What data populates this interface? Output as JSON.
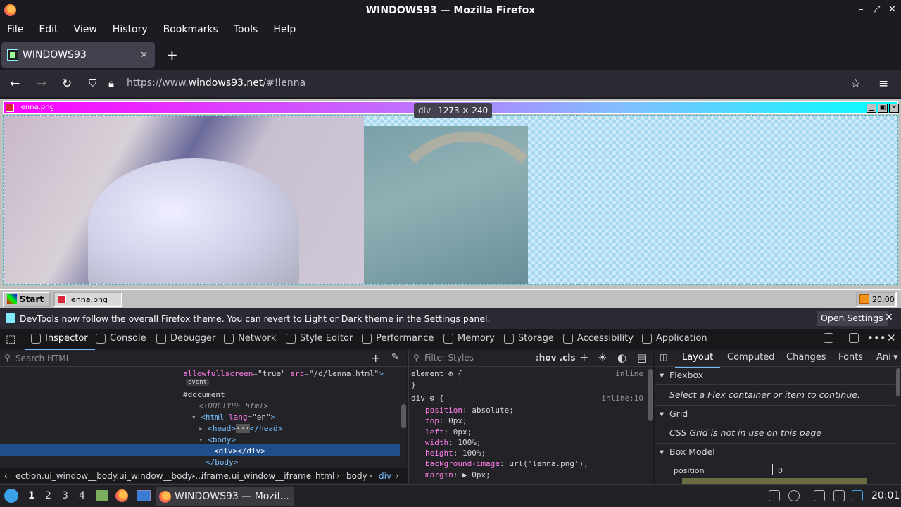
{
  "window": {
    "title": "WINDOWS93 — Mozilla Firefox"
  },
  "menubar": [
    "File",
    "Edit",
    "View",
    "History",
    "Bookmarks",
    "Tools",
    "Help"
  ],
  "tab": {
    "label": "WINDOWS93"
  },
  "navbar": {
    "url_prefix": "https://www.",
    "url_domain": "windows93.net",
    "url_suffix": "/#!lenna"
  },
  "win93": {
    "window_label": "lenna.png",
    "tooltip_tag": "div",
    "tooltip_size": "1273 × 240",
    "start_label": "Start",
    "task_label": "lenna.png",
    "clock": "20:00"
  },
  "notice": {
    "text": "DevTools now follow the overall Firefox theme. You can revert to Light or Dark theme in the Settings panel.",
    "button": "Open Settings"
  },
  "devtools": {
    "tabs": [
      "Inspector",
      "Console",
      "Debugger",
      "Network",
      "Style Editor",
      "Performance",
      "Memory",
      "Storage",
      "Accessibility",
      "Application"
    ],
    "search_placeholder": "Search HTML",
    "filter_placeholder": "Filter Styles",
    "pseudo": ":hov .cls",
    "html_lines": {
      "l1_att": "allowfullscreen",
      "l1_val": "\"true\"",
      "l1_src_att": "src",
      "l1_src_val": "\"/d/lenna.html\"",
      "event": "event",
      "document": "#document",
      "doctype": "<!DOCTYPE html>",
      "html_open": "<html",
      "lang_att": "lang",
      "lang_val": "\"en\"",
      "head": "<head>",
      "head_close": "</head>",
      "body": "<body>",
      "div": "<div></div>",
      "body_close": "</body>"
    },
    "breadcrumbs": [
      "ection.ui_window__body.ui_window__body-...",
      "iframe.ui_window__iframe",
      "html",
      "body",
      "div"
    ],
    "rules": {
      "element": "element",
      "element_src": "inline",
      "selector": "div",
      "selector_src": "inline:10",
      "props": [
        {
          "name": "position",
          "value": "absolute;"
        },
        {
          "name": "top",
          "value": "0px;"
        },
        {
          "name": "left",
          "value": "0px;"
        },
        {
          "name": "width",
          "value": "100%;"
        },
        {
          "name": "height",
          "value": "100%;"
        },
        {
          "name": "background-image",
          "value": "url('lenna.png');"
        },
        {
          "name": "margin",
          "value": "▶ 0px;"
        }
      ]
    },
    "layout_tabs": [
      "Layout",
      "Computed",
      "Changes",
      "Fonts",
      "Ani"
    ],
    "sections": {
      "flexbox": "Flexbox",
      "flexbox_msg": "Select a Flex container or item to continue.",
      "grid": "Grid",
      "grid_msg": "CSS Grid is not in use on this page",
      "boxmodel": "Box Model",
      "position_label": "position",
      "position_value": "0"
    }
  },
  "ospanel": {
    "workspaces": [
      "1",
      "2",
      "3",
      "4"
    ],
    "app_label": "WINDOWS93 — Mozil...",
    "clock": "20:01"
  }
}
